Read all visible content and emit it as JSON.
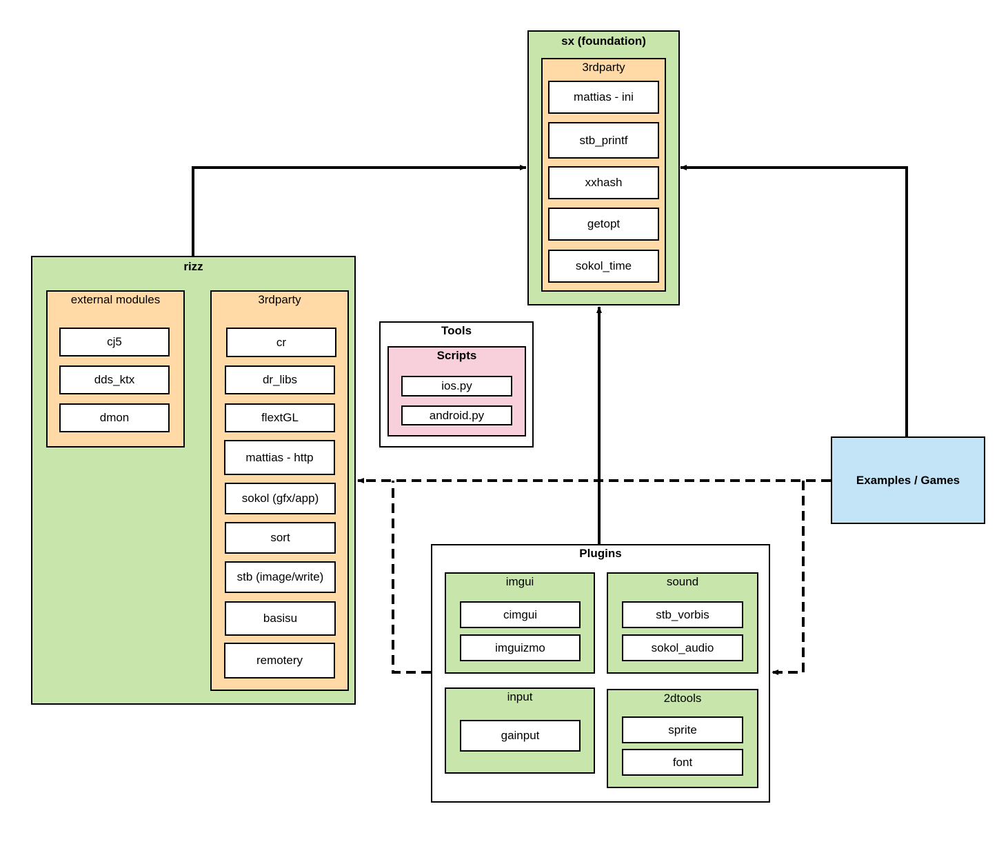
{
  "colors": {
    "green": "#c8e6ac",
    "orange": "#ffd9a6",
    "pink": "#f8d0dc",
    "blue": "#c3e4f6"
  },
  "sx": {
    "title": "sx (foundation)",
    "thirdparty": {
      "title": "3rdparty",
      "items": [
        "mattias - ini",
        "stb_printf",
        "xxhash",
        "getopt",
        "sokol_time"
      ]
    }
  },
  "rizz": {
    "title": "rizz",
    "external": {
      "title": "external modules",
      "items": [
        "cj5",
        "dds_ktx",
        "dmon"
      ]
    },
    "thirdparty": {
      "title": "3rdparty",
      "items": [
        "cr",
        "dr_libs",
        "flextGL",
        "mattias - http",
        "sokol (gfx/app)",
        "sort",
        "stb (image/write)",
        "basisu",
        "remotery"
      ]
    }
  },
  "tools": {
    "title": "Tools",
    "scripts": {
      "title": "Scripts",
      "items": [
        "ios.py",
        "android.py"
      ]
    }
  },
  "examples": {
    "title": "Examples / Games"
  },
  "plugins": {
    "title": "Plugins",
    "imgui": {
      "title": "imgui",
      "items": [
        "cimgui",
        "imguizmo"
      ]
    },
    "sound": {
      "title": "sound",
      "items": [
        "stb_vorbis",
        "sokol_audio"
      ]
    },
    "input": {
      "title": "input",
      "items": [
        "gainput"
      ]
    },
    "tools2d": {
      "title": "2dtools",
      "items": [
        "sprite",
        "font"
      ]
    }
  }
}
